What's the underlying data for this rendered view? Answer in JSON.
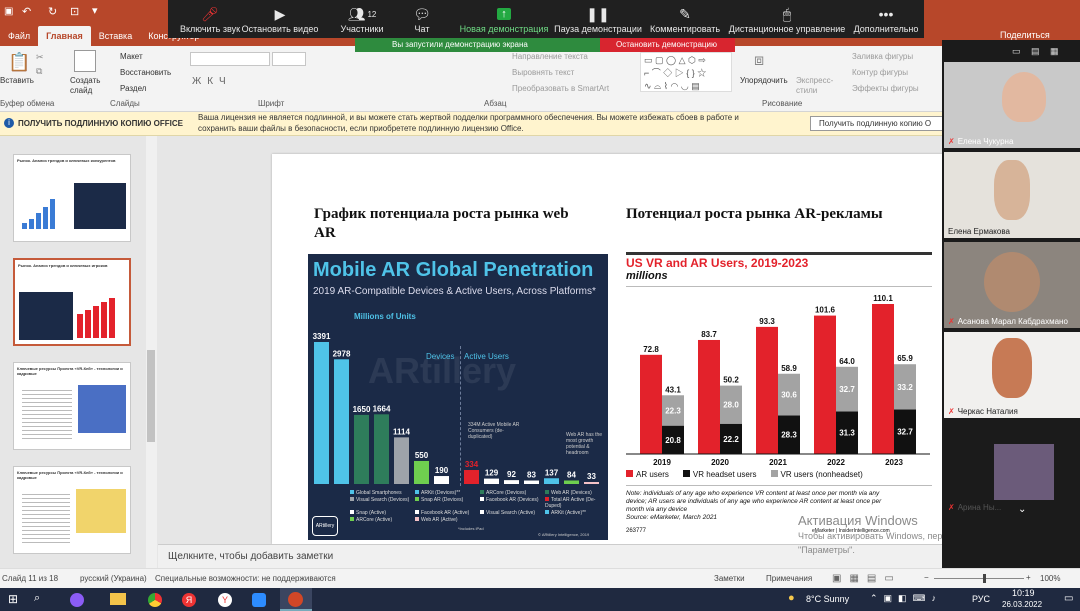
{
  "ribbon": {
    "tabs": [
      "Файл",
      "Главная",
      "Вставка",
      "Конструктор"
    ],
    "active_tab": "Главная",
    "groups": [
      "Буфер обмена",
      "Слайды",
      "Шрифт",
      "Абзац",
      "Рисование"
    ],
    "buttons": {
      "paste": "Вставить",
      "create_slide": "Создать слайд",
      "layout": "Макет",
      "restore": "Восстановить",
      "sections": "Раздел",
      "text_direction": "Направление текста",
      "align_text": "Выровнять текст",
      "smartart": "Преобразовать в SmartArt",
      "arrange": "Упорядочить",
      "quick_styles": "Экспресс-стили",
      "fill": "Заливка фигуры",
      "outline": "Контур фигуры",
      "effects": "Эффекты фигуры",
      "share": "Поделиться"
    }
  },
  "zoom": {
    "mute": "Включить звук",
    "video": "Остановить видео",
    "participants": "Участники",
    "participants_count": "12",
    "chat": "Чат",
    "new_share": "Новая демонстрация",
    "pause_share": "Пауза демонстрации",
    "annotate": "Комментировать",
    "remote": "Дистанционное управление",
    "more": "Дополнительно",
    "banner": "Вы запустили демонстрацию экрана",
    "stop": "Остановить демонстрацию"
  },
  "warning": {
    "title": "ПОЛУЧИТЬ ПОДЛИННУЮ КОПИЮ OFFICE",
    "message_1": "Ваша лицензия не является подлинной, и вы можете стать жертвой подделки программного обеспечения. Вы можете избежать сбоев в работе и",
    "message_2": "сохранить ваши файлы в безопасности, если приобретете подлинную лицензию Office.",
    "button": "Получить подлинную копию O"
  },
  "thumbnails": [
    {
      "number": "",
      "title": "Рынок. Анализ трендов и ключевых конкурентов"
    },
    {
      "number": "",
      "title": "Рынок. Анализ трендов и ключевых игроков"
    },
    {
      "number": "",
      "title": "Ключевые ресурсы Проекта «VR-Кей» - технологии и кадровые"
    },
    {
      "number": "",
      "title": "Ключевые ресурсы Проекта «VR-Кей» - технологии и кадровые"
    }
  ],
  "slide": {
    "left_heading": "График потенциала роста рынка web AR",
    "right_heading": "Потенциал роста рынка AR-рекламы"
  },
  "ar_chart": {
    "title": "Mobile AR Global Penetration",
    "subtitle": "2019 AR-Compatible Devices & Active Users, Across Platforms*",
    "units": "Millions of Units",
    "devices_label": "Devices",
    "users_label": "Active Users",
    "watermark": "ARtillery",
    "note": "334M Active Mobile AR Consumers (de-duplicated)",
    "web_note": "Web AR has the most growth potential & headroom",
    "legend": [
      "Global Smartphones",
      "Web AR (Devices)",
      "Facebook AR (Devices)",
      "Visual Search (Devices)",
      "ARKit (Devices)**",
      "ARCore (Devices)",
      "Snap AR (Devices)",
      "Total AR Active (De-Duped)",
      "Snap (Active)",
      "Visual Search (Active)",
      "Facebook AR (Active)",
      "ARKit (Active)**",
      "ARCore (Active)",
      "Web AR (Active)"
    ],
    "footnote": "*Includes iPad",
    "source": "© ARtillery Intelligence, 2019",
    "colors": {
      "bg": "#1b2a47",
      "blue": "#4fc3e8",
      "green": "#2e7d5b",
      "gray": "#9ea3aa",
      "lime": "#6fcf4f",
      "red": "#e3222b",
      "pink": "#f4c2c7",
      "white": "#ffffff"
    }
  },
  "vr_chart": {
    "title": "US VR and AR Users, 2019-2023",
    "subtitle": "millions",
    "legend": [
      "AR users",
      "VR headset users",
      "VR users (nonheadset)"
    ],
    "note_1": "Note: individuals of any age who experience VR content at least once per month via any",
    "note_2": "device; AR users are individuals of any age who experience AR content at least once per",
    "note_3": "month via any device",
    "source": "Source: eMarketer, March 2021",
    "id": "263777",
    "brand": "eMarketer | InsiderIntelligence.com",
    "colors": {
      "ar": "#e3222b",
      "vr_headset": "#111111",
      "vr_nonheadset": "#a3a3a3"
    }
  },
  "chart_data": [
    {
      "type": "bar",
      "title": "Mobile AR Global Penetration",
      "subtitle": "2019 AR-Compatible Devices & Active Users, Across Platforms*",
      "ylabel": "Millions of Units",
      "categories": [
        "Global Smartphones",
        "ARKit (Devices)**",
        "ARCore (Devices)",
        "Web AR (Devices)",
        "Visual Search (Devices)",
        "Snap AR (Devices)",
        "Facebook AR (Devices)",
        "Total AR Active (De-Duped)",
        "Snap (Active)",
        "Facebook AR (Active)",
        "Visual Search (Active)",
        "ARKit (Active)**",
        "ARCore (Active)",
        "Web AR (Active)"
      ],
      "values": [
        3391,
        2978,
        1650,
        1664,
        1114,
        550,
        190,
        334,
        129,
        92,
        83,
        137,
        84,
        33
      ],
      "bar_colors": [
        "#4fc3e8",
        "#4fc3e8",
        "#2e7d5b",
        "#2e7d5b",
        "#9ea3aa",
        "#6fcf4f",
        "#ffffff",
        "#e3222b",
        "#ffffff",
        "#ffffff",
        "#ffffff",
        "#4fc3e8",
        "#6fcf4f",
        "#f4c2c7"
      ]
    },
    {
      "type": "bar",
      "title": "US VR and AR Users, 2019-2023",
      "ylabel": "millions",
      "categories": [
        "2019",
        "2020",
        "2021",
        "2022",
        "2023"
      ],
      "series": [
        {
          "name": "AR users",
          "values": [
            72.8,
            83.7,
            93.3,
            101.6,
            110.1
          ]
        },
        {
          "name": "VR headset users",
          "values": [
            20.8,
            22.2,
            28.3,
            31.3,
            32.7
          ]
        },
        {
          "name": "VR users (nonheadset)",
          "values": [
            22.3,
            28.0,
            30.6,
            32.7,
            33.2
          ]
        }
      ],
      "stack_totals": [
        43.1,
        50.2,
        58.9,
        64.0,
        65.9
      ]
    }
  ],
  "notes_placeholder": "Щелкните, чтобы добавить заметки",
  "status": {
    "slide": "Слайд 11 из 18",
    "language": "русский (Украина)",
    "accessibility": "Специальные возможности: не поддерживаются",
    "notes": "Заметки",
    "comments": "Примечания",
    "zoom": "100%"
  },
  "activation": {
    "title": "Активация Windows",
    "text_1": "Чтобы активировать Windows, перейдите в раздел",
    "text_2": "\"Параметры\"."
  },
  "participants": [
    {
      "name": "Елена Чукурна",
      "muted": true
    },
    {
      "name": "Елена Ермакова",
      "muted": false
    },
    {
      "name": "Асанова Марал Кабдрахмано",
      "muted": true
    },
    {
      "name": "Черкас Наталия",
      "muted": true
    },
    {
      "name": "Арина Ны...",
      "muted": true
    }
  ],
  "taskbar": {
    "weather": "8°C  Sunny",
    "lang": "РУС",
    "time": "10:19",
    "date": "26.03.2022"
  }
}
